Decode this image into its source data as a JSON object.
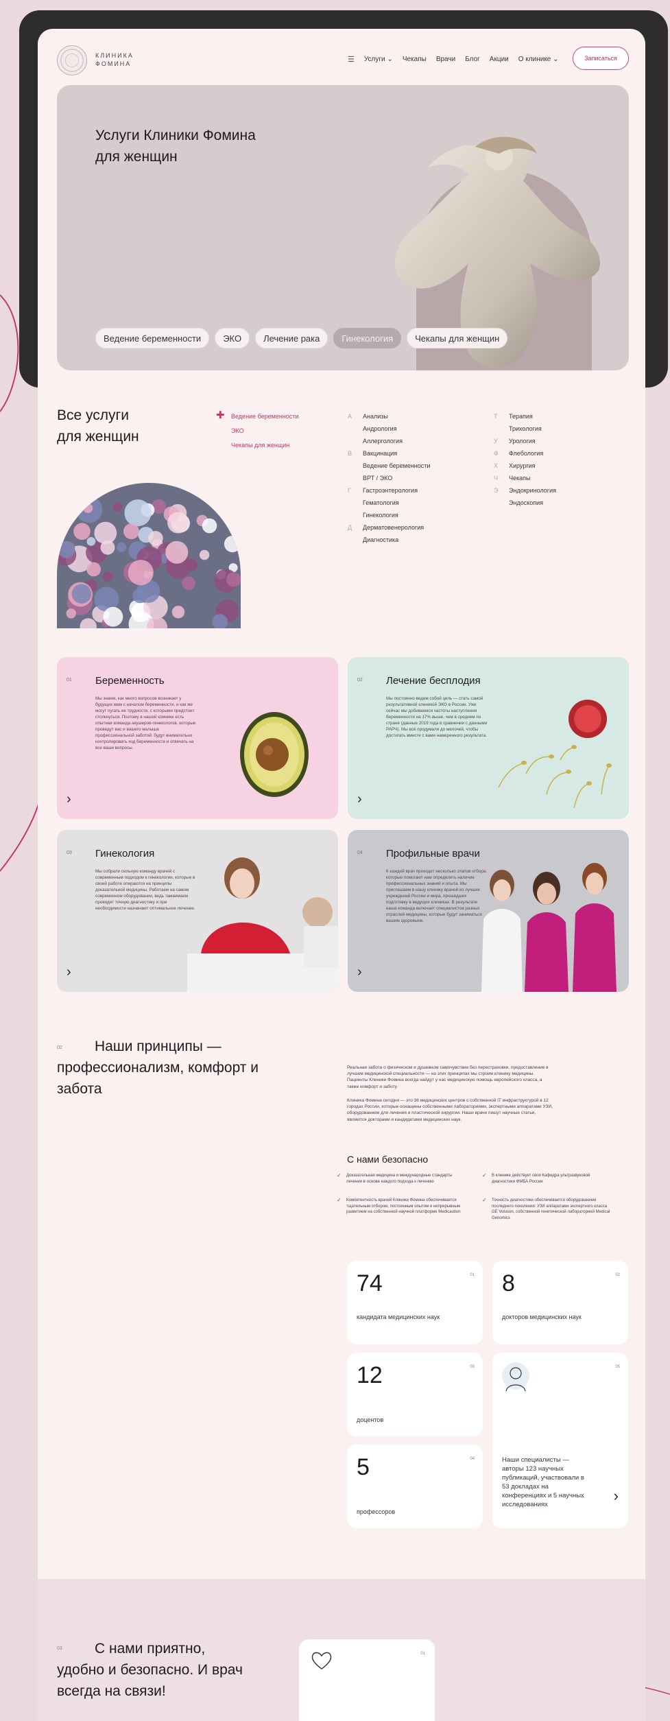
{
  "header": {
    "logo_line1": "КЛИНИКА",
    "logo_line2": "ФОМИНА",
    "nav": [
      {
        "label": "Услуги",
        "caret": true
      },
      {
        "label": "Чекапы",
        "caret": false
      },
      {
        "label": "Врачи",
        "caret": false
      },
      {
        "label": "Блог",
        "caret": false
      },
      {
        "label": "Акции",
        "caret": false
      },
      {
        "label": "О клинике",
        "caret": true
      }
    ],
    "cta": "Записаться"
  },
  "hero": {
    "title_line1": "Услуги Клиники Фомина",
    "title_line2": "для женщин",
    "pills": [
      "Ведение беременности",
      "ЭКО",
      "Лечение рака",
      "Гинекология",
      "Чекапы для женщин"
    ],
    "active_pill": 3
  },
  "services": {
    "title_line1": "Все услуги",
    "title_line2": "для женщин",
    "categories": [
      "Ведение беременности",
      "ЭКО",
      "Чекапы для женщин"
    ],
    "col1": [
      {
        "letter": "А",
        "label": "Анализы"
      },
      {
        "letter": "",
        "label": "Андрология"
      },
      {
        "letter": "",
        "label": "Аллергология"
      },
      {
        "letter": "В",
        "label": "Вакцинация"
      },
      {
        "letter": "",
        "label": "Ведение беременности"
      },
      {
        "letter": "",
        "label": "ВРТ / ЭКО"
      },
      {
        "letter": "Г",
        "label": "Гастроэнтерология"
      },
      {
        "letter": "",
        "label": "Гематология"
      },
      {
        "letter": "",
        "label": "Гинекология"
      },
      {
        "letter": "Д",
        "label": "Дерматовенерология"
      },
      {
        "letter": "",
        "label": "Диагностика"
      }
    ],
    "col2": [
      {
        "letter": "Т",
        "label": "Терапия"
      },
      {
        "letter": "",
        "label": "Трихология"
      },
      {
        "letter": "У",
        "label": "Урология"
      },
      {
        "letter": "Ф",
        "label": "Флебология"
      },
      {
        "letter": "Х",
        "label": "Хирургия"
      },
      {
        "letter": "Ч",
        "label": "Чекапы"
      },
      {
        "letter": "Э",
        "label": "Эндокринология"
      },
      {
        "letter": "",
        "label": "Эндоскопия"
      }
    ]
  },
  "cards": [
    {
      "num": "01",
      "title": "Беременность",
      "text": "Мы знаем, как много вопросов возникает у будущих мам с началом беременности, и как же могут пугать ее трудности, с которыми предстоит столкнуться. Поэтому в нашей клинике есть опытная команда акушеров-гинекологов, которые проведут вас и вашего малыша профессиональной заботой: будут внимательно контролировать ход беременности и отвечать на все ваши вопросы."
    },
    {
      "num": "02",
      "title": "Лечение бесплодия",
      "text": "Мы постоянно ведем собой цель — стать самой результативной клиникой ЭКО в России. Уже сейчас мы добиваемся частоты наступления беременности на 17% выше, чем в среднем по стране (данные 2019 года в сравнении с данными РАРЧ). Мы всё продумали до мелочей, чтобы достигать вместе с вами намеренного результата."
    },
    {
      "num": "03",
      "title": "Гинекология",
      "text": "Мы собрали сильную команду врачей с современным подходом к гинекологии, которые в своей работе опираются на принципы доказательной медицины. Работаем на самом современном оборудовании, ведь тамаимаем проводят точную диагностику и при необходимости назначают оптимальное лечение."
    },
    {
      "num": "04",
      "title": "Профильные врачи",
      "text": "К каждой врач проходит несколько этапов отбора, которые помогают нам определить наличие профессиональных знаний и опыта. Мы приглашаем в нашу клинику врачей из лучших учреждений России и мира, прошедших подготовку в ведущих клиниках. В результате наша команда включает специалистов разных отраслей медицины, которые будут заниматься вашим здоровьем."
    }
  ],
  "principles": {
    "num": "02",
    "title": "Наши принципы — профессионализм, комфорт и забота",
    "para1": "Реальная забота о физическом и душевном самочувствии без перестраховки, предоставление в лучшем медицинской специальности — на этих принципах мы строим клинику медицины. Пациенты Клиники Фомина всегда найдут у нас медицинскую помощь европейского класса, а также комфорт и заботу.",
    "para2": "Клиника Фомина сегодня — это 36 медицинских центров с собственной IT инфраструктурой в 12 городах России, которые оснащены собственными лабораториями, экспертными аппаратами УЗИ, оборудованием для лечения и пластической хирургии. Наши врачи пишут научные статьи, являются докторами и кандидатами медицинских наук.",
    "safe_title": "С нами безопасно",
    "checks": [
      "Доказательная медицина и международные стандарты лечения в основе каждого подхода к лечению",
      "В клинике действует своя Кафедра ультразвуковой диагностики ФМБА России",
      "Компетентность врачей Клиники Фомина обеспечивается тщательным отбором, постоянным опытом и непрерывным развитием на собственной научной платформе Medicaution",
      "Точность диагностики обеспечивается оборудованием последнего поколения: УЗИ аппаратами экспертного класса GE Voluson, собственной генетической лабораторией Medical Genomics"
    ]
  },
  "stats": [
    {
      "value": "74",
      "num": "01",
      "caption": "кандидата медицинских наук"
    },
    {
      "value": "8",
      "num": "02",
      "caption": "докторов медицинских наук"
    },
    {
      "value": "12",
      "num": "03",
      "caption": "доцентов"
    },
    {
      "value": "5",
      "num": "04",
      "caption": "профессоров"
    },
    {
      "value": "",
      "num": "05",
      "caption": "Наши специалисты — авторы 123 научных публикаций, участвовали в 53 докладах на конференциях и 5 научных исследованиях"
    }
  ],
  "bottom": {
    "num": "03",
    "title": "С нами приятно, удобно и безопасно. И врач всегда на связи!",
    "card_num": "01"
  }
}
